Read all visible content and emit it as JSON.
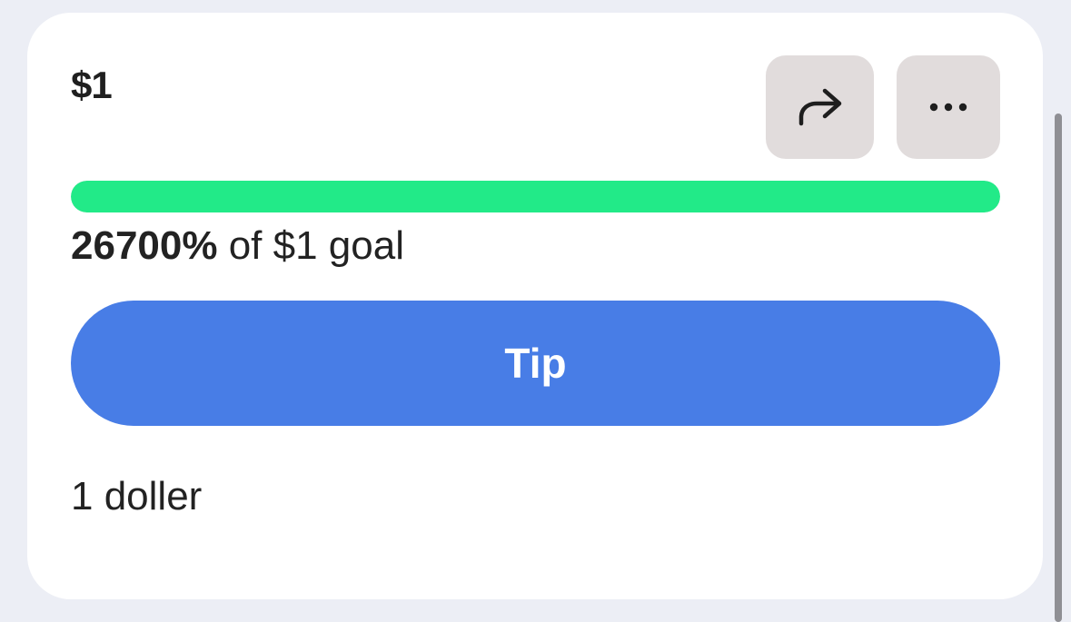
{
  "card": {
    "amount_label": "$1",
    "actions": {
      "share_icon": "share-arrow-icon",
      "more_icon": "more-dots-icon"
    },
    "progress": {
      "fill_fraction": 1.0,
      "fill_color": "#22ea88",
      "percent_text": "26700%",
      "goal_suffix": " of $1 goal"
    },
    "tip_button_label": "Tip",
    "tip_button_color": "#487de6",
    "description": "1 doller"
  }
}
